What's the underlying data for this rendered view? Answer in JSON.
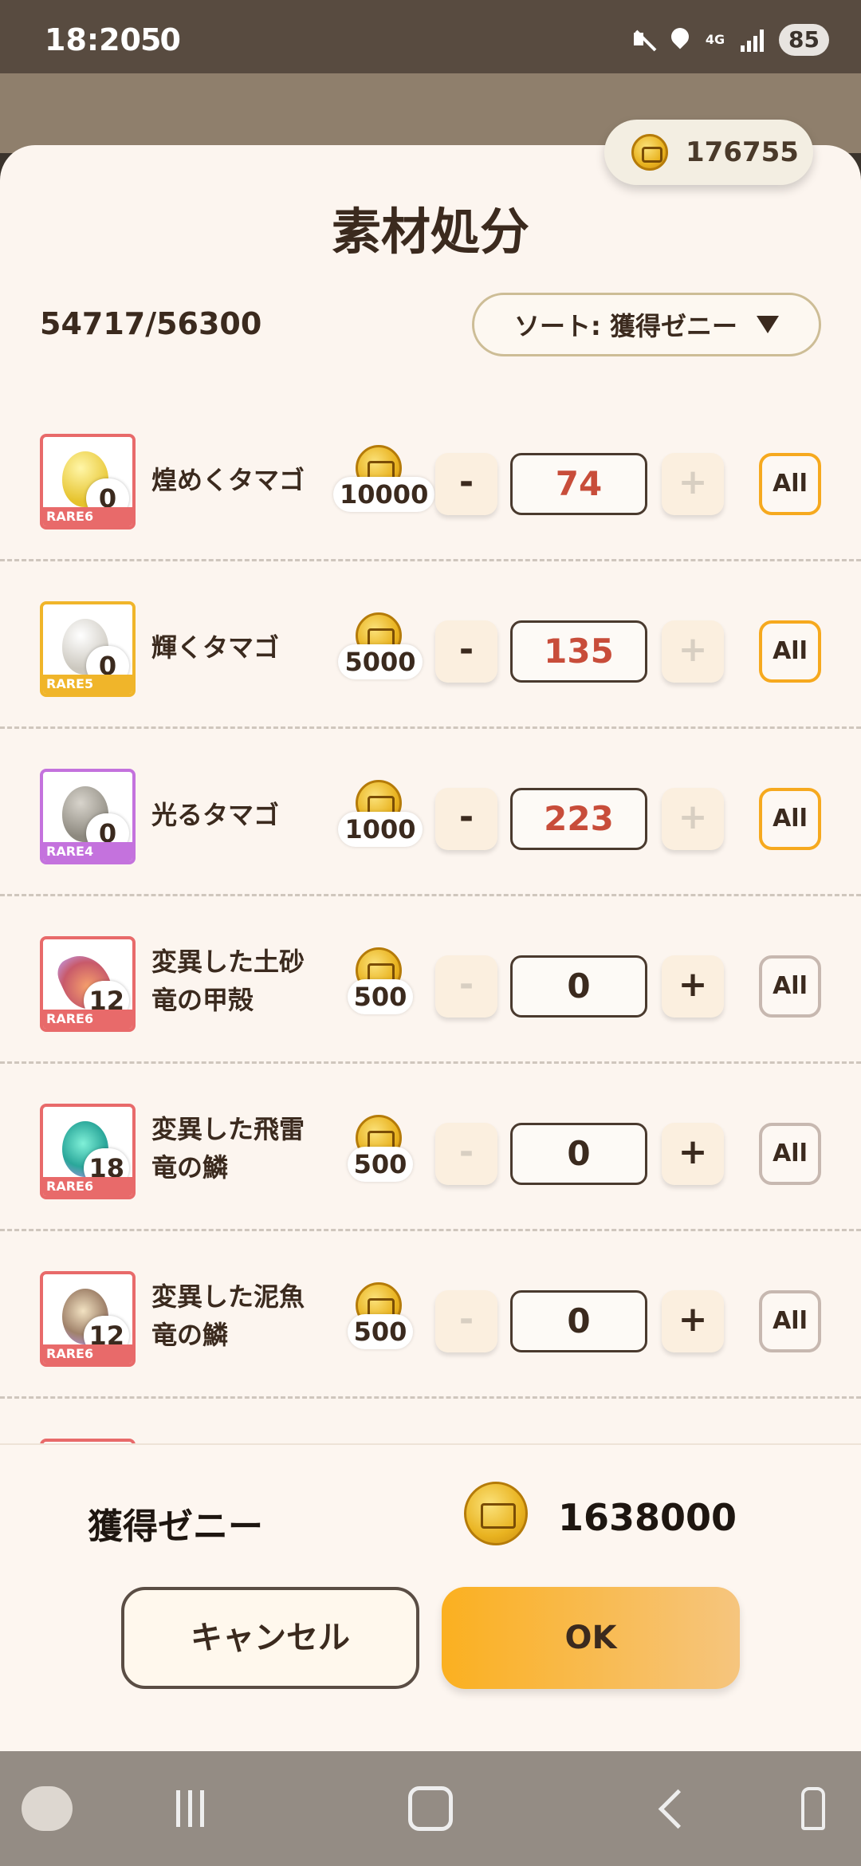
{
  "status_bar": {
    "time": "18:20",
    "extra": "50",
    "network": "4G",
    "battery": "85"
  },
  "sheet": {
    "title": "素材処分",
    "zeny_balance": "176755",
    "capacity": "54717/56300",
    "sort_label": "ソート: 獲得ゼニー"
  },
  "items": [
    {
      "name": "煌めくタマゴ",
      "owned": "0",
      "rarity": "RARE6",
      "price": "10000",
      "quantity": "74",
      "minus": "-",
      "plus": "+",
      "all": "All"
    },
    {
      "name": "輝くタマゴ",
      "owned": "0",
      "rarity": "RARE5",
      "price": "5000",
      "quantity": "135",
      "minus": "-",
      "plus": "+",
      "all": "All"
    },
    {
      "name": "光るタマゴ",
      "owned": "0",
      "rarity": "RARE4",
      "price": "1000",
      "quantity": "223",
      "minus": "-",
      "plus": "+",
      "all": "All"
    },
    {
      "name_line1": "変異した土砂",
      "name_line2": "竜の甲殻",
      "owned": "12",
      "rarity": "RARE6",
      "price": "500",
      "quantity": "0",
      "minus": "-",
      "plus": "+",
      "all": "All"
    },
    {
      "name_line1": "変異した飛雷",
      "name_line2": "竜の鱗",
      "owned": "18",
      "rarity": "RARE6",
      "price": "500",
      "quantity": "0",
      "minus": "-",
      "plus": "+",
      "all": "All"
    },
    {
      "name_line1": "変異した泥魚",
      "name_line2": "竜の鱗",
      "owned": "12",
      "rarity": "RARE6",
      "price": "500",
      "quantity": "0",
      "minus": "-",
      "plus": "+",
      "all": "All"
    }
  ],
  "footer": {
    "earned_label": "獲得ゼニー",
    "earned_value": "1638000",
    "cancel_label": "キャンセル",
    "ok_label": "OK"
  },
  "colors": {
    "accent": "#f6a91e",
    "quantity_active": "#c84d3a",
    "rare6": "#e86a6a",
    "rare5": "#f0b52a",
    "rare4": "#c472dd"
  },
  "icons": [
    "mute-icon",
    "location-icon",
    "signal-icon",
    "coin-icon",
    "sort-arrow-icon",
    "egg-icon",
    "shell-icon",
    "scale-icon"
  ]
}
